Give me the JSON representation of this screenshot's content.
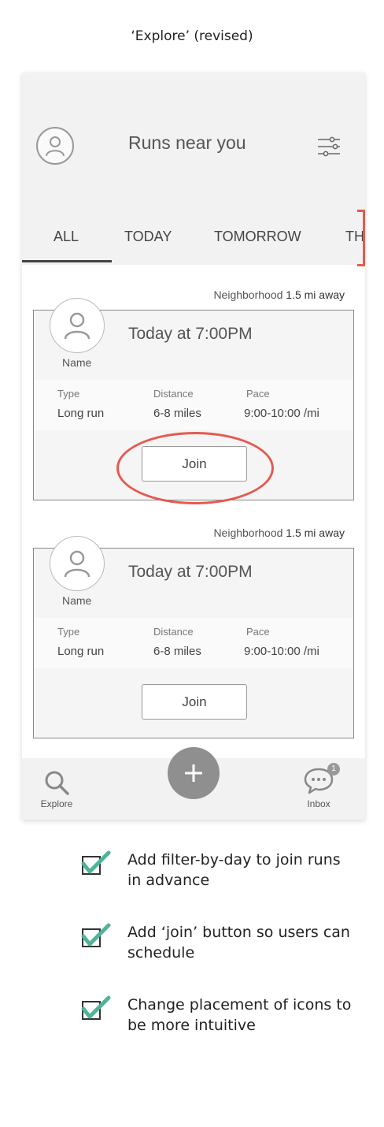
{
  "caption": "‘Explore’ (revised)",
  "header": {
    "title": "Runs near you",
    "avatar_icon": "user-icon",
    "filter_icon": "sliders-icon"
  },
  "tabs": [
    "ALL",
    "TODAY",
    "TOMORROW",
    "TH"
  ],
  "active_tab": "ALL",
  "runs": [
    {
      "location": "Neighborhood",
      "distance_away": "1.5 mi away",
      "name": "Name",
      "time": "Today at 7:00PM",
      "type_label": "Type",
      "type_value": "Long run",
      "distance_label": "Distance",
      "distance_value": "6-8 miles",
      "pace_label": "Pace",
      "pace_value": "9:00-10:00 /mi",
      "join_label": "Join"
    },
    {
      "location": "Neighborhood",
      "distance_away": "1.5 mi away",
      "name": "Name",
      "time": "Today at 7:00PM",
      "type_label": "Type",
      "type_value": "Long run",
      "distance_label": "Distance",
      "distance_value": "6-8 miles",
      "pace_label": "Pace",
      "pace_value": "9:00-10:00 /mi",
      "join_label": "Join"
    }
  ],
  "bottom_nav": {
    "explore_label": "Explore",
    "inbox_label": "Inbox",
    "inbox_badge": "1",
    "add_icon": "plus-icon"
  },
  "annotations": {
    "accent_color": "#e55a4f",
    "check_color": "#4fb39a",
    "items": [
      "Add filter-by-day to join runs in advance",
      "Add ‘join’ button so users can schedule",
      "Change placement of icons to be more intuitive"
    ]
  }
}
